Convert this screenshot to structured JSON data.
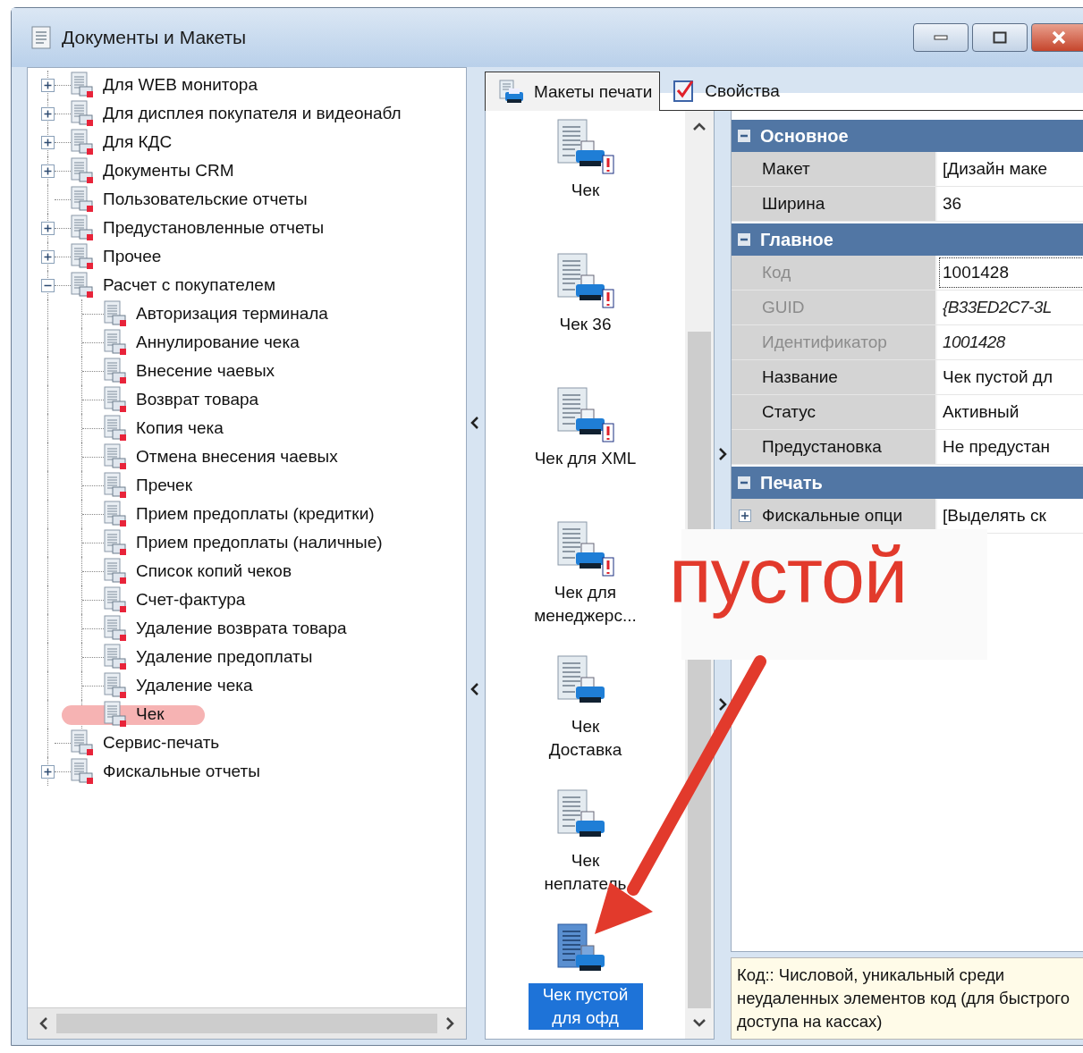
{
  "window": {
    "title": "Документы и Макеты"
  },
  "tree": [
    {
      "label": "Для WEB монитора",
      "kind": "collapsed"
    },
    {
      "label": "Для дисплея покупателя и видеонабл",
      "kind": "collapsed"
    },
    {
      "label": "Для КДС",
      "kind": "collapsed"
    },
    {
      "label": "Документы CRM",
      "kind": "collapsed"
    },
    {
      "label": "Пользовательские отчеты",
      "kind": "leaf"
    },
    {
      "label": "Предустановленные отчеты",
      "kind": "collapsed"
    },
    {
      "label": "Прочее",
      "kind": "collapsed"
    },
    {
      "label": "Расчет с покупателем",
      "kind": "expanded",
      "children": [
        {
          "label": "Авторизация терминала",
          "highlighted": false
        },
        {
          "label": "Аннулирование чека",
          "highlighted": false
        },
        {
          "label": "Внесение чаевых",
          "highlighted": false
        },
        {
          "label": "Возврат товара",
          "highlighted": false
        },
        {
          "label": "Копия чека",
          "highlighted": false
        },
        {
          "label": "Отмена внесения чаевых",
          "highlighted": false
        },
        {
          "label": "Пречек",
          "highlighted": false
        },
        {
          "label": "Прием предоплаты (кредитки)",
          "highlighted": false
        },
        {
          "label": "Прием предоплаты (наличные)",
          "highlighted": false
        },
        {
          "label": "Список копий чеков",
          "highlighted": false
        },
        {
          "label": "Счет-фактура",
          "highlighted": false
        },
        {
          "label": "Удаление возврата товара",
          "highlighted": false
        },
        {
          "label": "Удаление предоплаты",
          "highlighted": false
        },
        {
          "label": "Удаление чека",
          "highlighted": false
        },
        {
          "label": "Чек",
          "highlighted": true
        }
      ]
    },
    {
      "label": "Сервис-печать",
      "kind": "leaf"
    },
    {
      "label": "Фискальные отчеты",
      "kind": "collapsed"
    }
  ],
  "tabs": [
    {
      "label": "Макеты печати",
      "selected": true
    },
    {
      "label": "Свойства",
      "selected": false
    }
  ],
  "layouts": [
    {
      "label": "Чек",
      "warning": true,
      "selected": false
    },
    {
      "label": "Чек 36",
      "warning": true,
      "selected": false
    },
    {
      "label": "Чек для XML",
      "warning": true,
      "selected": false
    },
    {
      "label": "Чек для менеджерс...",
      "warning": true,
      "selected": false
    },
    {
      "label": "Чек Доставка",
      "warning": false,
      "selected": false
    },
    {
      "label": "Чек неплатель",
      "warning": false,
      "selected": false
    },
    {
      "label": "Чек пустой для офд",
      "warning": false,
      "selected": true
    }
  ],
  "properties": [
    {
      "title": "Основное",
      "expanded": true,
      "rows": [
        {
          "name": "Макет",
          "kind": "text",
          "value": "[Дизайн маке",
          "readonly": false,
          "computed": false,
          "focused": false
        },
        {
          "name": "Ширина",
          "kind": "text",
          "value": "36",
          "readonly": false,
          "computed": false,
          "focused": false
        }
      ]
    },
    {
      "title": "Главное",
      "expanded": true,
      "rows": [
        {
          "name": "Код",
          "kind": "text",
          "value": "1001428",
          "readonly": true,
          "computed": false,
          "focused": true
        },
        {
          "name": "GUID",
          "kind": "text",
          "value": "{B33ED2C7-3L",
          "readonly": true,
          "computed": true,
          "focused": false
        },
        {
          "name": "Идентификатор",
          "kind": "text",
          "value": "1001428",
          "readonly": true,
          "computed": true,
          "focused": false
        },
        {
          "name": "Название",
          "kind": "text",
          "value": "Чек пустой дл",
          "readonly": false,
          "computed": false,
          "focused": false
        },
        {
          "name": "Статус",
          "kind": "text",
          "value": "Активный",
          "readonly": false,
          "computed": false,
          "focused": false
        },
        {
          "name": "Предустановка",
          "kind": "text",
          "value": "Не предустан",
          "readonly": false,
          "computed": false,
          "focused": false
        }
      ]
    },
    {
      "title": "Печать",
      "expanded": true,
      "rows": [
        {
          "name": "Фискальные опци",
          "kind": "group",
          "expanded": false,
          "value": "[Выделять ск",
          "readonly": false,
          "computed": false,
          "focused": false
        }
      ]
    }
  ],
  "description": "Код:: Числовой, уникальный среди неудаленных элементов код (для быстрого доступа на кассах)",
  "annotation": {
    "text": "пустой"
  }
}
